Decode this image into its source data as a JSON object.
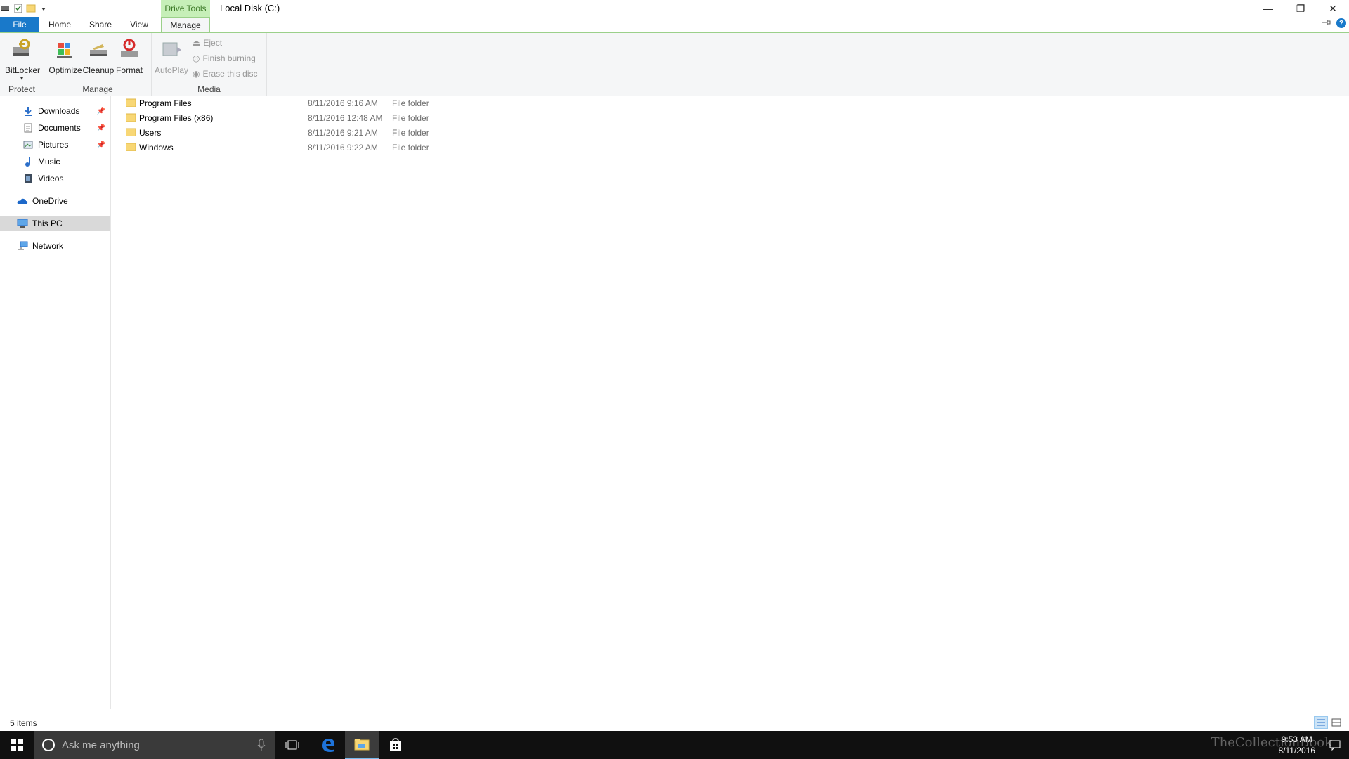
{
  "window": {
    "title": "Local Disk (C:)",
    "context_tab_group": "Drive Tools",
    "controls": {
      "minimize": "—",
      "restore": "❐",
      "close": "✕"
    }
  },
  "tabs": [
    {
      "label": "File"
    },
    {
      "label": "Home"
    },
    {
      "label": "Share"
    },
    {
      "label": "View"
    },
    {
      "label": "Manage"
    }
  ],
  "ribbon": {
    "groups": {
      "protect": "Protect",
      "manage": "Manage",
      "media": "Media"
    },
    "buttons": {
      "bitlocker": "BitLocker",
      "optimize": "Optimize",
      "cleanup": "Cleanup",
      "format": "Format",
      "autoplay": "AutoPlay",
      "eject": "Eject",
      "finish_burning": "Finish burning",
      "erase_disc": "Erase this disc"
    }
  },
  "nav": {
    "items": [
      {
        "label": "Downloads",
        "icon": "download-icon",
        "pinned": true
      },
      {
        "label": "Documents",
        "icon": "documents-icon",
        "pinned": true
      },
      {
        "label": "Pictures",
        "icon": "pictures-icon",
        "pinned": true
      },
      {
        "label": "Music",
        "icon": "music-icon",
        "pinned": false
      },
      {
        "label": "Videos",
        "icon": "videos-icon",
        "pinned": false
      },
      {
        "label": "OneDrive",
        "icon": "onedrive-icon",
        "pinned": false
      },
      {
        "label": "This PC",
        "icon": "computer-icon",
        "pinned": false
      },
      {
        "label": "Network",
        "icon": "network-icon",
        "pinned": false
      }
    ],
    "selected": "This PC"
  },
  "files": [
    {
      "name": "Program Files",
      "date": "8/11/2016 9:16 AM",
      "type": "File folder"
    },
    {
      "name": "Program Files (x86)",
      "date": "8/11/2016 12:48 AM",
      "type": "File folder"
    },
    {
      "name": "Users",
      "date": "8/11/2016 9:21 AM",
      "type": "File folder"
    },
    {
      "name": "Windows",
      "date": "8/11/2016 9:22 AM",
      "type": "File folder"
    }
  ],
  "status": {
    "items_count": "5 items"
  },
  "taskbar": {
    "search_placeholder": "Ask me anything",
    "clock_time": "9:53 AM",
    "clock_date": "8/11/2016",
    "watermark": "TheCollectionBook"
  },
  "colors": {
    "file_tab": "#1979ca",
    "context_tab": "#c6efb8",
    "folder": "#f8d775",
    "taskbar": "#101010"
  }
}
